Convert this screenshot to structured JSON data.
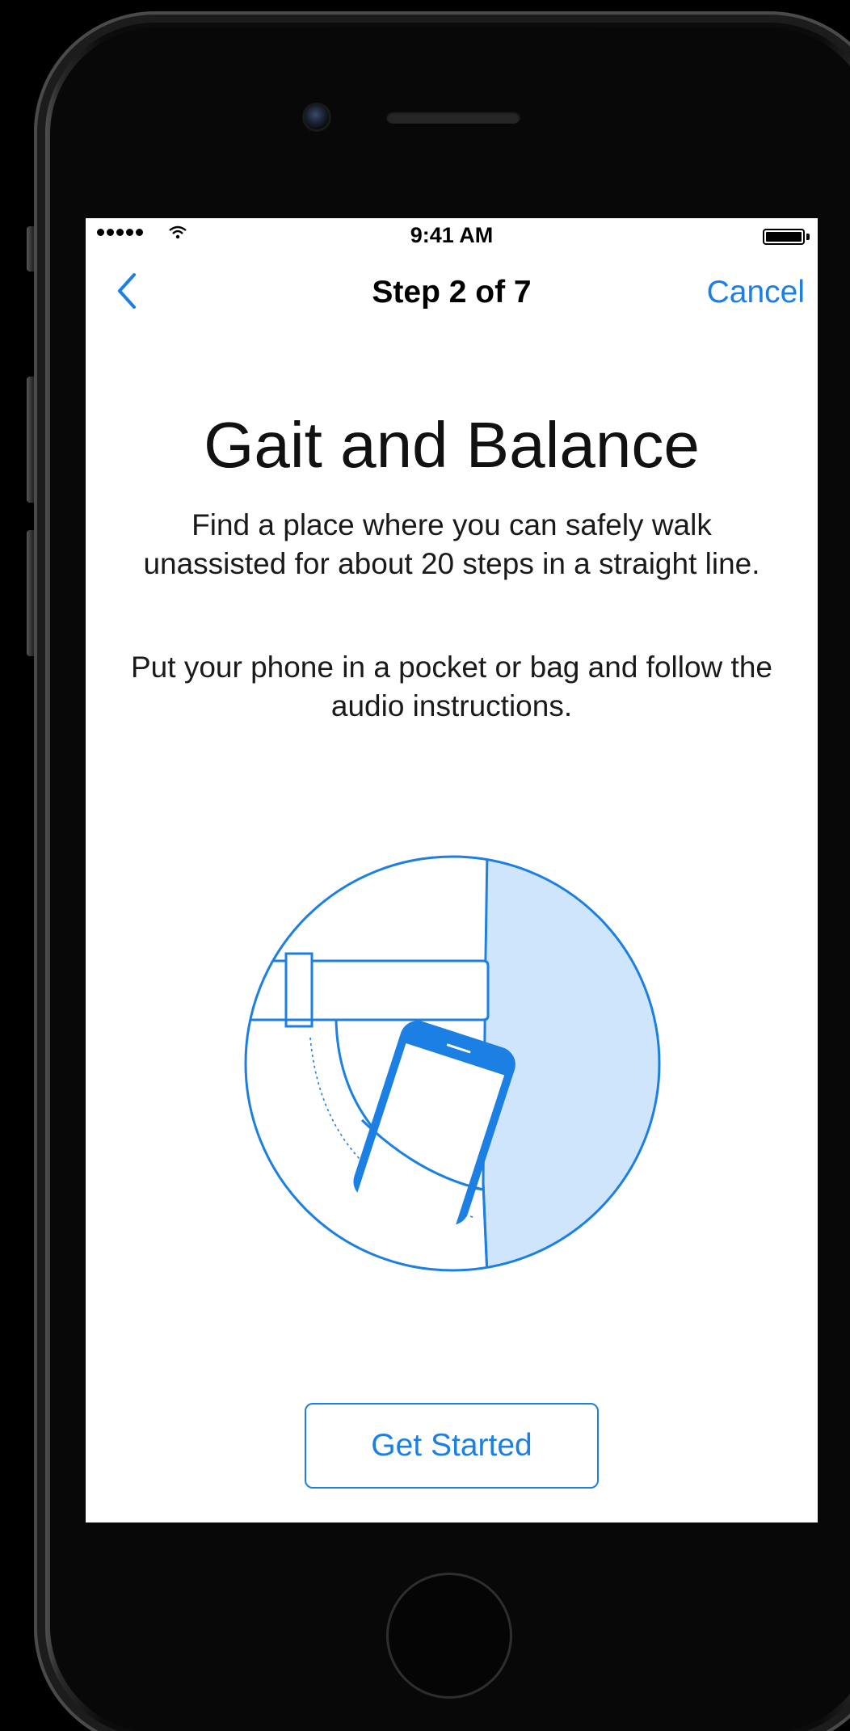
{
  "status_bar": {
    "time": "9:41 AM"
  },
  "nav": {
    "back_icon": "chevron-left-icon",
    "title": "Step 2 of 7",
    "cancel_label": "Cancel"
  },
  "content": {
    "heading": "Gait and Balance",
    "paragraph_1": "Find a place where you can safely walk unassisted for about 20 steps in a straight line.",
    "paragraph_2": "Put your phone in a pocket or bag and follow the audio instructions.",
    "illustration_icon": "phone-in-pocket-illustration",
    "button_label": "Get Started"
  },
  "colors": {
    "accent": "#1b7fe3",
    "illustration_fill": "#cfe5fb",
    "background": "#ffffff"
  }
}
